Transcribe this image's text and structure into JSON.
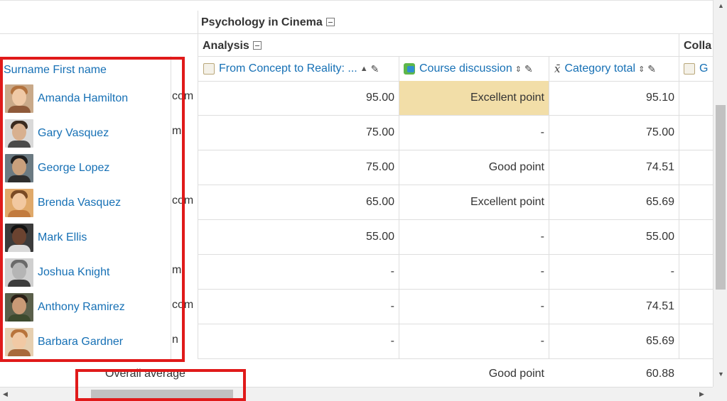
{
  "categories": {
    "course": "Psychology in Cinema",
    "analysis": "Analysis",
    "collab": "Colla"
  },
  "headers": {
    "name": "Surname First name",
    "concept": "From Concept to Reality: ...",
    "discussion": "Course discussion",
    "total": "Category total",
    "next": "G"
  },
  "students": [
    {
      "name": "Amanda Hamilton",
      "email": "com",
      "concept": "95.00",
      "discussion": "Excellent point",
      "total": "95.10"
    },
    {
      "name": "Gary Vasquez",
      "email": "m",
      "concept": "75.00",
      "discussion": "-",
      "total": "75.00"
    },
    {
      "name": "George Lopez",
      "email": "",
      "concept": "75.00",
      "discussion": "Good point",
      "total": "74.51"
    },
    {
      "name": "Brenda Vasquez",
      "email": "com",
      "concept": "65.00",
      "discussion": "Excellent point",
      "total": "65.69"
    },
    {
      "name": "Mark Ellis",
      "email": "",
      "concept": "55.00",
      "discussion": "-",
      "total": "55.00"
    },
    {
      "name": "Joshua Knight",
      "email": "m",
      "concept": "-",
      "discussion": "-",
      "total": "-"
    },
    {
      "name": "Anthony Ramirez",
      "email": "com",
      "concept": "-",
      "discussion": "-",
      "total": "74.51"
    },
    {
      "name": "Barbara Gardner",
      "email": "n",
      "concept": "-",
      "discussion": "-",
      "total": "65.69"
    }
  ],
  "overall": {
    "label": "Overall average",
    "discussion": "Good point",
    "total": "60.88"
  },
  "icons": {
    "collapse": "collapse-icon",
    "assignment": "assignment-icon",
    "forum": "forum-icon",
    "total": "category-total-icon",
    "edit": "pencil-icon",
    "sort": "sort-arrows-icon"
  },
  "colors": {
    "link": "#1670b5",
    "highlight": "#f2dea8",
    "annotation": "#e01a1a"
  }
}
